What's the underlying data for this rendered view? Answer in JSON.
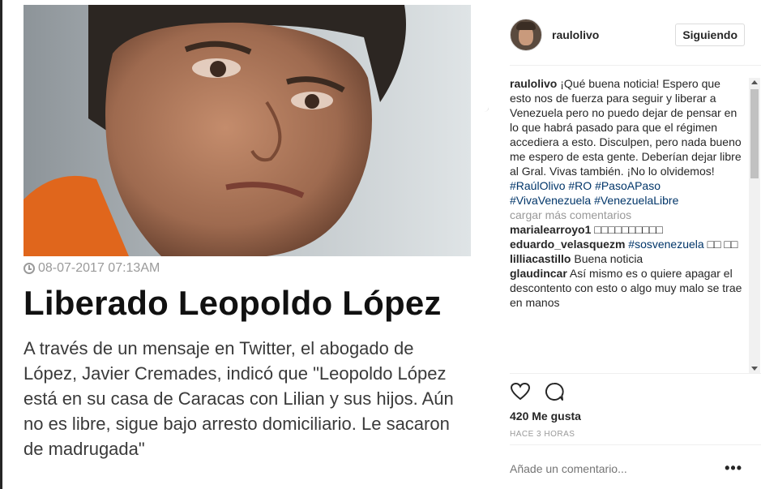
{
  "article": {
    "date": "08-07-2017 07:13AM",
    "headline": "Liberado Leopoldo López",
    "body": "A través de un mensaje en Twitter, el abogado de López, Javier Cremades, indicó que \"Leopoldo López está en su casa de Caracas con Lilian y sus hijos. Aún no es libre, sigue bajo arresto domiciliario. Le sacaron de madrugada\""
  },
  "header": {
    "username": "raulolivo",
    "follow_label": "Siguiendo"
  },
  "caption": {
    "user": "raulolivo",
    "text": "¡Qué buena noticia! Espero que esto nos de fuerza para seguir y liberar a Venezuela pero no puedo dejar de pensar en lo que habrá pasado para que el régimen accediera a esto. Disculpen, pero nada bueno me espero de esta gente. Deberían dejar libre al Gral. Vivas también. ¡No lo olvidemos!",
    "hashtags": [
      "#RaúlOlivo",
      "#RO",
      "#PasoAPaso",
      "#VivaVenezuela",
      "#VenezuelaLibre"
    ]
  },
  "load_more": "cargar más comentarios",
  "comments": [
    {
      "user": "marialearroyo1",
      "text": "□□□□□□□□□□",
      "tag": ""
    },
    {
      "user": "eduardo_velasquezm",
      "text": "□□ □□",
      "tag": "#sosvenezuela"
    },
    {
      "user": "lilliacastillo",
      "text": "Buena noticia",
      "tag": ""
    },
    {
      "user": "glaudincar",
      "text": "Así mismo es o quiere apagar el descontento con esto o algo muy malo se trae en manos",
      "tag": ""
    }
  ],
  "likes": "420 Me gusta",
  "time": "HACE 3 HORAS",
  "add_comment_placeholder": "Añade un comentario...",
  "more_options": "•••"
}
